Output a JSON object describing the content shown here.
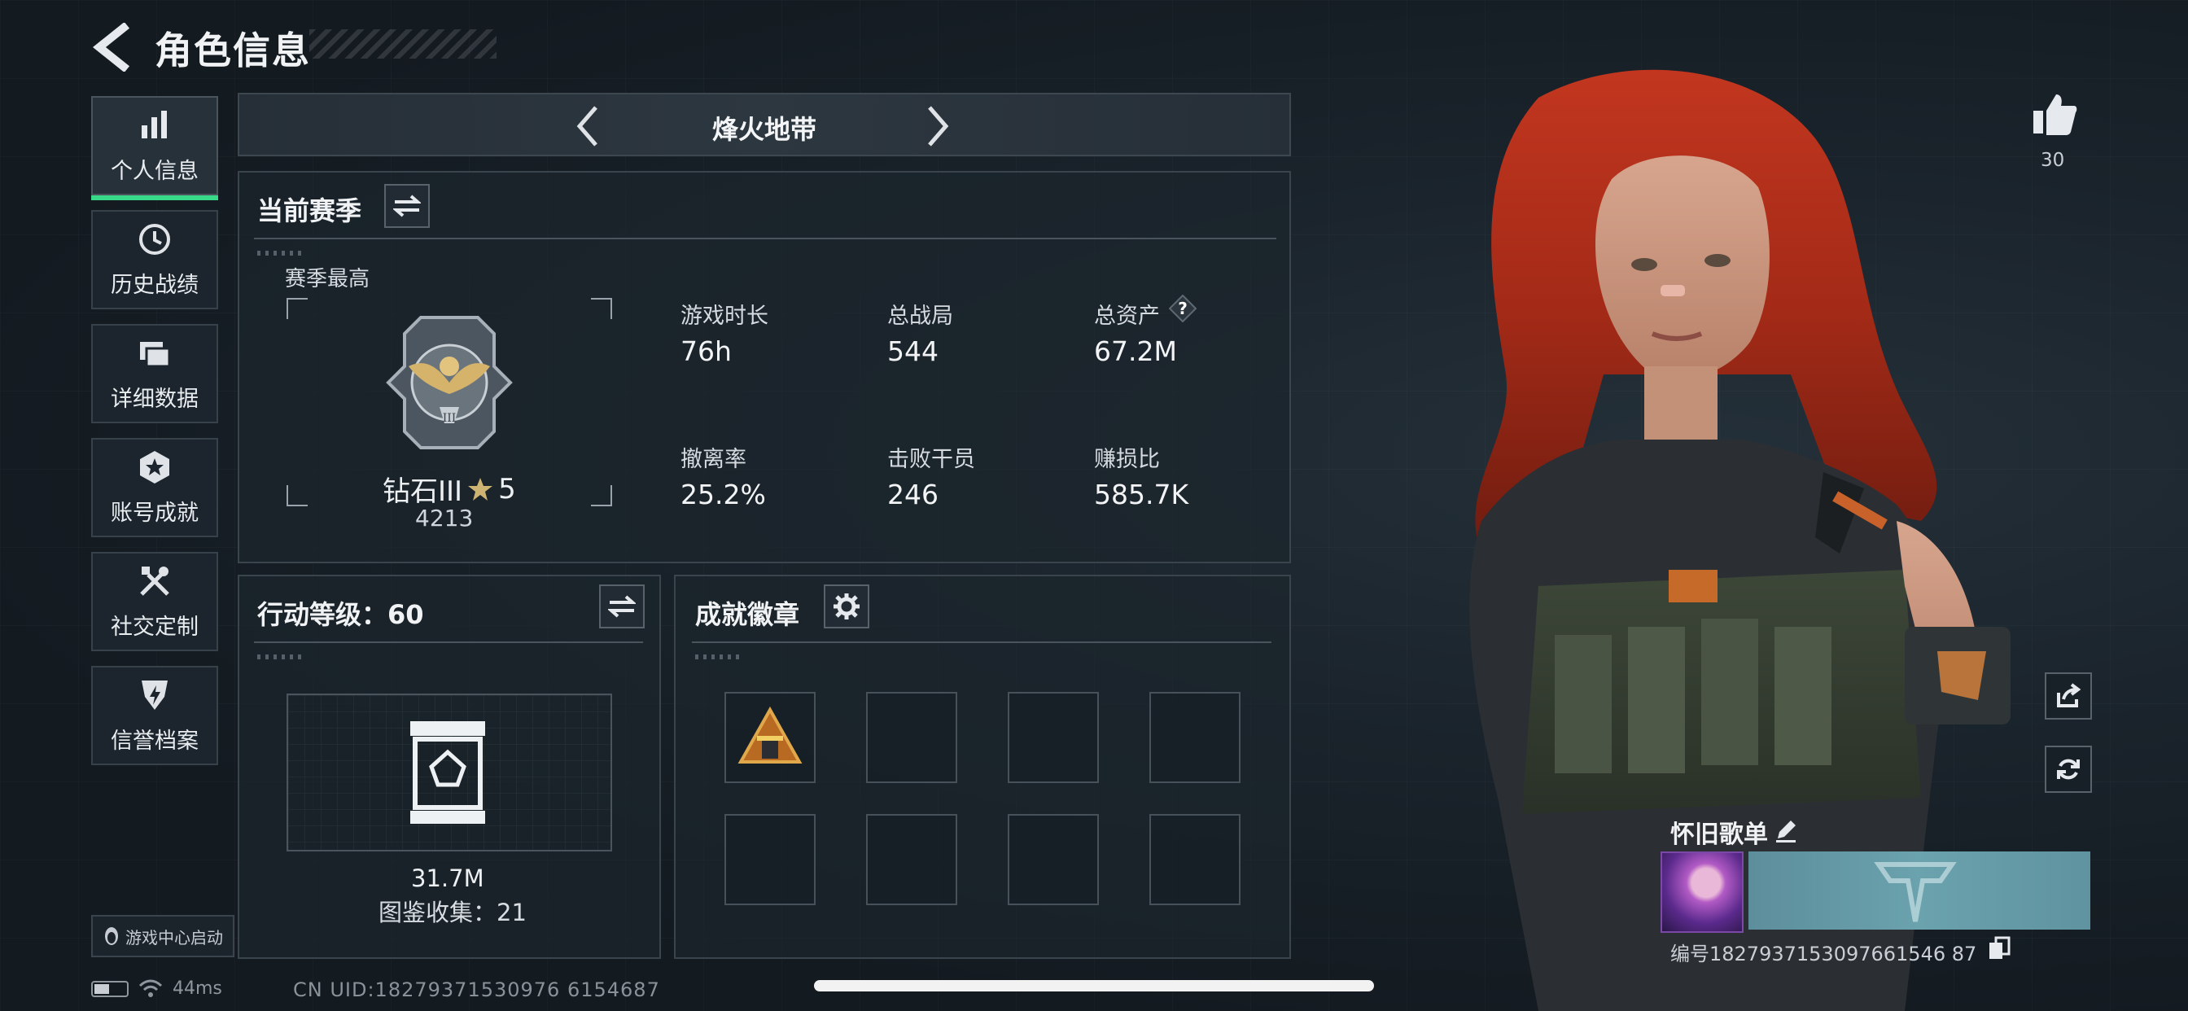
{
  "header": {
    "title": "角色信息"
  },
  "sidebar": {
    "items": [
      {
        "label": "个人信息",
        "icon": "bar-chart-icon",
        "active": true
      },
      {
        "label": "历史战绩",
        "icon": "history-clock-icon"
      },
      {
        "label": "详细数据",
        "icon": "cards-icon"
      },
      {
        "label": "账号成就",
        "icon": "achievement-star-icon"
      },
      {
        "label": "社交定制",
        "icon": "tools-icon"
      },
      {
        "label": "信誉档案",
        "icon": "credit-shield-icon"
      }
    ],
    "launch_label": "游戏中心启动"
  },
  "game_switch": {
    "title": "烽火地带"
  },
  "season": {
    "title": "当前赛季",
    "best_label": "赛季最高",
    "rank_name": "钻石III",
    "rank_stars": "5",
    "rank_score": "4213",
    "stats": [
      {
        "label": "游戏时长",
        "value": "76h"
      },
      {
        "label": "总战局",
        "value": "544"
      },
      {
        "label": "总资产",
        "value": "67.2M",
        "help": "?"
      },
      {
        "label": "撤离率",
        "value": "25.2%"
      },
      {
        "label": "击败干员",
        "value": "246"
      },
      {
        "label": "赚损比",
        "value": "585.7K"
      }
    ]
  },
  "action_level": {
    "title": "行动等级：60",
    "collection_value": "31.7M",
    "collection_count": "图鉴收集：21"
  },
  "achievements": {
    "title": "成就徽章",
    "slots_total": 8,
    "filled_slots": 1
  },
  "profile": {
    "likes": "30",
    "playlist_name": "怀旧歌单",
    "card_id": "编号1827937153097661546 87"
  },
  "status": {
    "ping": "44ms",
    "uid": "CN UID:18279371530976 6154687"
  },
  "colors": {
    "accent": "#39d98a",
    "background": "#141b21",
    "panel_border": "#3a444d"
  }
}
